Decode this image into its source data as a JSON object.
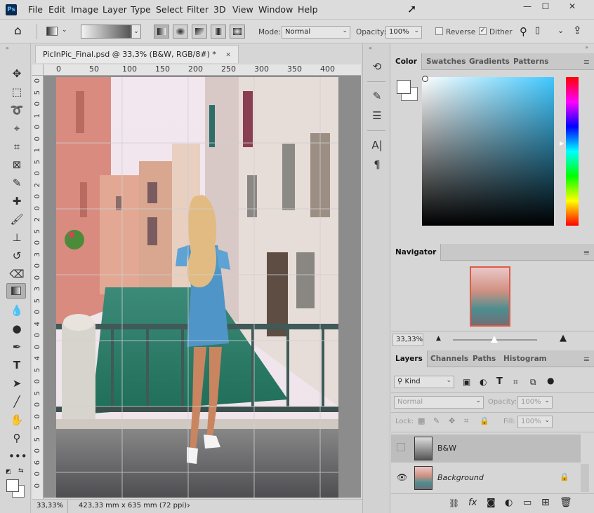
{
  "app": {
    "logo_text": "Ps"
  },
  "menu": [
    "File",
    "Edit",
    "Image",
    "Layer",
    "Type",
    "Select",
    "Filter",
    "3D",
    "View",
    "Window",
    "Help"
  ],
  "window_controls": {
    "minimize": "—",
    "maximize": "☐",
    "close": "✕"
  },
  "options": {
    "mode_label": "Mode:",
    "mode_value": "Normal",
    "opacity_label": "Opacity:",
    "opacity_value": "100%",
    "reverse_label": "Reverse",
    "dither_label": "Dither",
    "reverse_checked": false,
    "dither_checked": true
  },
  "document": {
    "tab_title": "PicInPic_Final.psd @ 33,3% (B&W, RGB/8#) *",
    "close_glyph": "✕",
    "ruler_top": [
      "0",
      "50",
      "100",
      "150",
      "200",
      "250",
      "300",
      "350",
      "400"
    ],
    "ruler_left": [
      "0",
      "5",
      "0",
      "1",
      "0",
      "0",
      "1",
      "5",
      "0",
      "2",
      "0",
      "0",
      "2",
      "5",
      "0",
      "3",
      "0",
      "0",
      "3",
      "5",
      "0",
      "4",
      "0",
      "0",
      "4",
      "5",
      "0",
      "5",
      "0",
      "0",
      "5",
      "5",
      "0",
      "6",
      "0",
      "0"
    ],
    "zoom": "33,33%",
    "dimensions": "423,33 mm x 635 mm (72 ppi)",
    "status_arrow": "›"
  },
  "panels": {
    "color_tabs": [
      "Color",
      "Swatches",
      "Gradients",
      "Patterns"
    ],
    "navigator_tab": "Navigator",
    "navigator_zoom": "33,33%",
    "layers_tabs": [
      "Layers",
      "Channels",
      "Paths",
      "Histogram"
    ],
    "filter_kind": "Kind",
    "blend_mode": "Normal",
    "opacity_label": "Opacity:",
    "opacity_value": "100%",
    "lock_label": "Lock:",
    "fill_label": "Fill:",
    "fill_value": "100%",
    "layers": [
      {
        "name": "B&W",
        "visible": false,
        "selected": true,
        "locked": false
      },
      {
        "name": "Background",
        "visible": true,
        "selected": false,
        "locked": true
      }
    ]
  },
  "colors": {
    "accent": "#e05a4a",
    "panel": "#d6d6d6",
    "selected_layer": "#bdbdbd"
  }
}
